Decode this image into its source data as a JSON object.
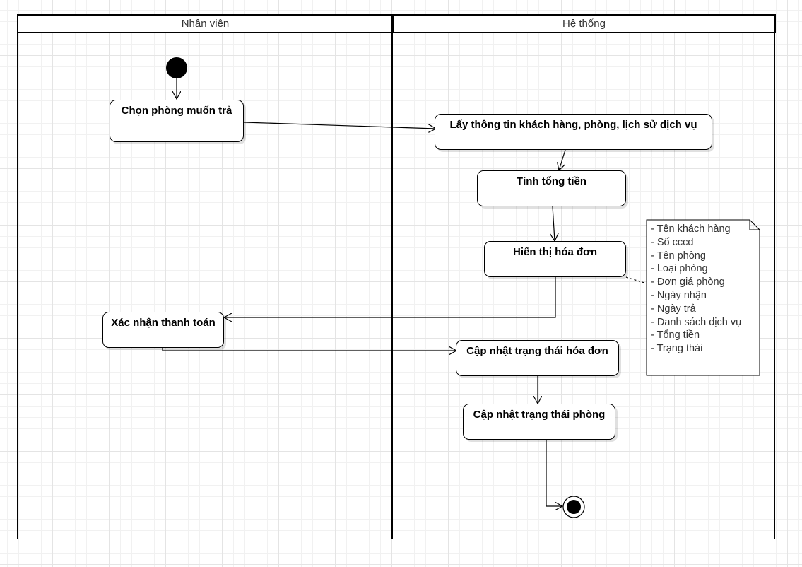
{
  "lanes": {
    "employee": "Nhân viên",
    "system": "Hệ thống"
  },
  "activities": {
    "select_room": "Chọn phòng muốn trả",
    "get_info": "Lấy thông tin khách hàng, phòng, lịch sử dịch vụ",
    "calc_total": "Tính tổng tiền",
    "show_invoice": "Hiển thị hóa đơn",
    "confirm_payment": "Xác nhận thanh toán",
    "update_invoice_status": "Cập nhật trạng thái hóa đơn",
    "update_room_status": "Cập nhật trạng thái phòng"
  },
  "note": [
    "- Tên khách hàng",
    "- Số cccd",
    "- Tên phòng",
    "- Loại phòng",
    "- Đơn giá phòng",
    "- Ngày nhận",
    "- Ngày trả",
    "- Danh sách dịch vụ",
    "- Tổng tiền",
    "- Trạng thái"
  ]
}
